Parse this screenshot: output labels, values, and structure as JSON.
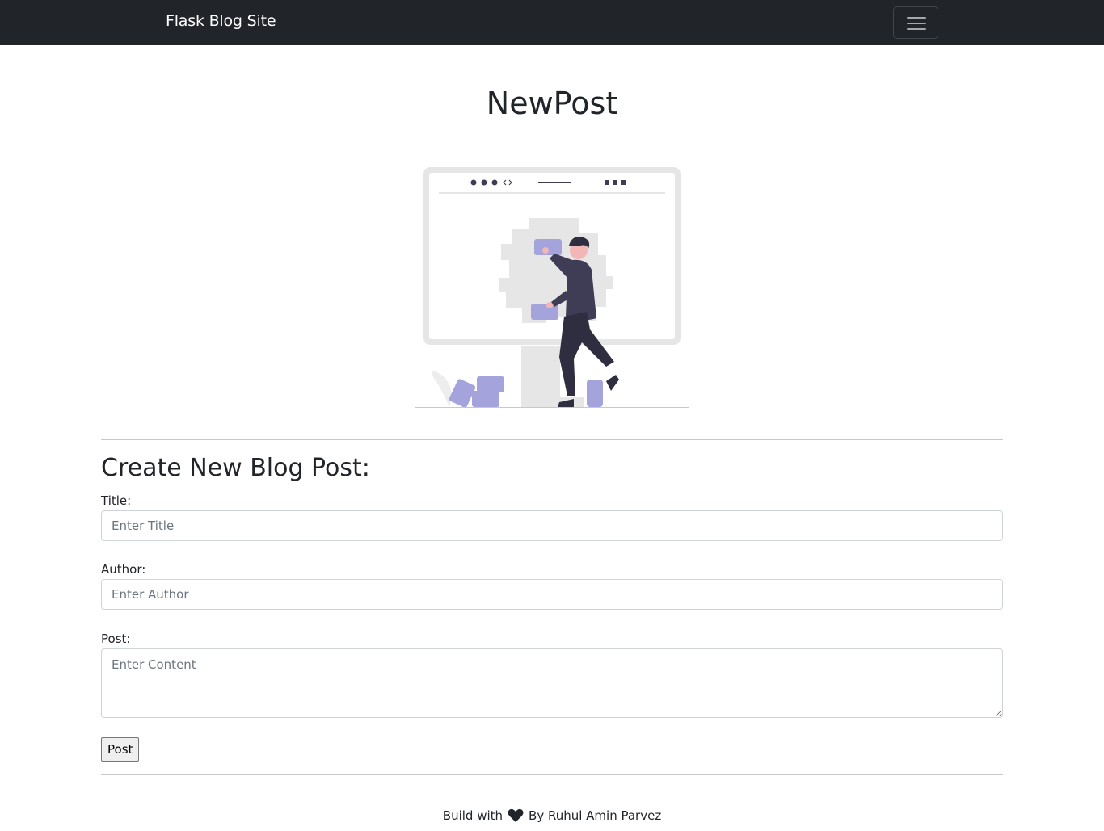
{
  "navbar": {
    "brand": "Flask Blog Site",
    "toggler_icon": "hamburger-menu-icon",
    "background": "#212529"
  },
  "page": {
    "title": "NewPost"
  },
  "illustration": {
    "icon": "person-building-website-illustration",
    "accent_color": "#a5a3dc"
  },
  "form": {
    "heading": "Create New Blog Post:",
    "title_label": "Title:",
    "title_placeholder": "Enter Title",
    "title_value": "",
    "author_label": "Author:",
    "author_placeholder": "Enter Author",
    "author_value": "",
    "post_label": "Post:",
    "post_placeholder": "Enter Content",
    "post_value": "",
    "submit_label": "Post"
  },
  "footer": {
    "text_before": "Build with",
    "heart_icon": "heart-icon",
    "text_after": "By Ruhul Amin Parvez"
  }
}
